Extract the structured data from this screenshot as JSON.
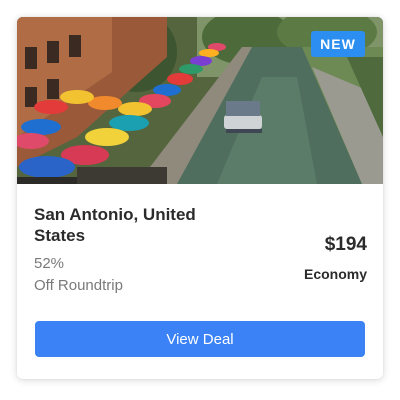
{
  "deal": {
    "badge": "NEW",
    "destination": "San Antonio, United States",
    "discount": "52%",
    "trip_type": "Off Roundtrip",
    "price": "$194",
    "fare_class": "Economy",
    "cta_label": "View Deal"
  },
  "colors": {
    "accent": "#3b82f6",
    "badge": "#2b8ef0"
  }
}
